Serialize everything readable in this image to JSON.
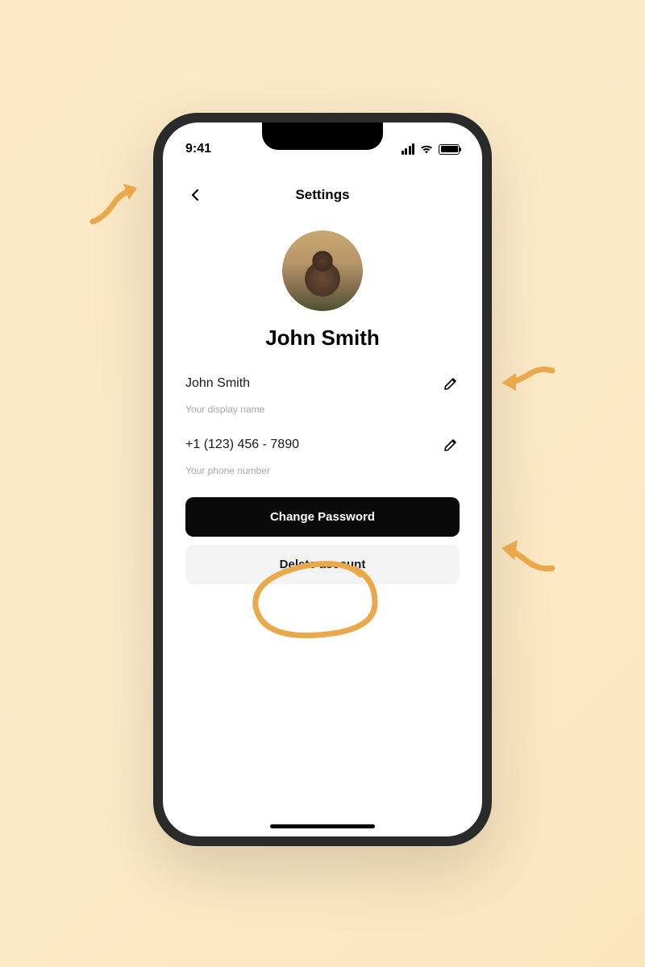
{
  "status_bar": {
    "time": "9:41"
  },
  "header": {
    "title": "Settings"
  },
  "profile": {
    "name": "John Smith"
  },
  "fields": {
    "display_name": {
      "value": "John Smith",
      "hint": "Your display name"
    },
    "phone": {
      "value": "+1 (123) 456 - 7890",
      "hint": "Your phone number"
    }
  },
  "buttons": {
    "change_password": "Change Password",
    "delete_account": "Delete account"
  },
  "annotation": {
    "color": "#e9a94a"
  }
}
